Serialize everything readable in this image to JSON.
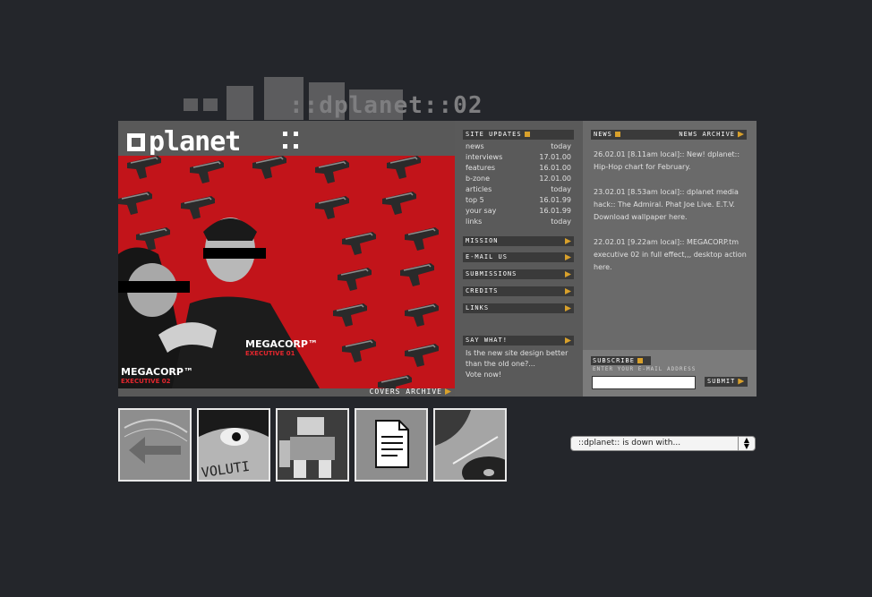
{
  "site": {
    "logo": "dplanet",
    "logo_suffix": "::",
    "bg_monogram": "dp",
    "tagline": "::dplanet::02"
  },
  "hero": {
    "caption_right_title": "MEGACORP™",
    "caption_right_sub": "EXECUTIVE 01",
    "caption_left_title": "MEGACORP™",
    "caption_left_sub": "EXECUTIVE 02",
    "covers_archive": "COVERS ARCHIVE"
  },
  "site_updates": {
    "title": "SITE UPDATES",
    "rows": [
      {
        "label": "news",
        "date": "today"
      },
      {
        "label": "interviews",
        "date": "17.01.00"
      },
      {
        "label": "features",
        "date": "16.01.00"
      },
      {
        "label": "b-zone",
        "date": "12.01.00"
      },
      {
        "label": "articles",
        "date": "today"
      },
      {
        "label": "top 5",
        "date": "16.01.99"
      },
      {
        "label": "your say",
        "date": "16.01.99"
      },
      {
        "label": "links",
        "date": "today"
      }
    ]
  },
  "menu": {
    "mission": "MISSION",
    "email_us": "E-MAIL US",
    "submissions": "SUBMISSIONS",
    "credits": "CREDITS",
    "links": "LINKS"
  },
  "say_what": {
    "title": "SAY WHAT!",
    "question": "Is the new site design better than the old one?...",
    "vote": "Vote now!"
  },
  "news": {
    "title": "NEWS",
    "archive": "NEWS ARCHIVE",
    "items": [
      "26.02.01 [8.11am local]:: New! dplanet:: Hip-Hop chart for February.",
      "23.02.01 [8.53am local]:: dplanet media hack:: The Admiral. Phat Joe Live. E.T.V. Download wallpaper here.",
      "22.02.01 [9.22am local]:: MEGACORP.tm executive 02 in full effect,,, desktop action here."
    ]
  },
  "subscribe": {
    "title": "SUBSCRIBE",
    "label": "ENTER YOUR E-MAIL ADDRESS",
    "placeholder": "",
    "submit": "SUBMIT"
  },
  "dropdown": {
    "selected": "::dplanet:: is down with..."
  },
  "colors": {
    "background": "#24262b",
    "accent": "#d8a02b",
    "hero_red": "#c2141a"
  }
}
